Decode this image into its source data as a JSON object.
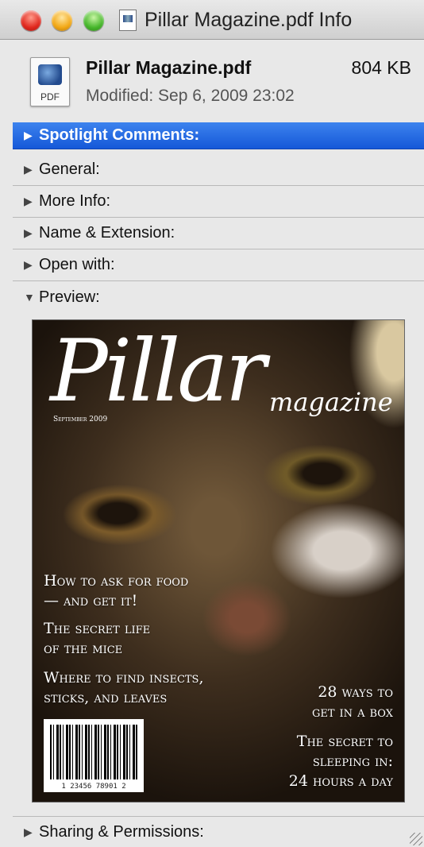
{
  "window": {
    "title": "Pillar Magazine.pdf Info"
  },
  "header": {
    "icon_label": "PDF",
    "file_name": "Pillar Magazine.pdf",
    "file_size": "804 KB",
    "modified": "Modified: Sep 6, 2009 23:02"
  },
  "sections": {
    "spotlight": "Spotlight Comments:",
    "general": "General:",
    "more_info": "More Info:",
    "name_extension": "Name & Extension:",
    "open_with": "Open with:",
    "preview": "Preview:",
    "sharing": "Sharing & Permissions:"
  },
  "triangles": {
    "collapsed": "▶",
    "expanded": "▼"
  },
  "cover": {
    "title": "Pillar",
    "subtitle": "magazine",
    "date": "September 2009",
    "headline1": "How to ask for food\n— and get it!",
    "headline2": "The secret life\nof the mice",
    "headline3": "Where to find insects,\nsticks, and leaves",
    "headline4": "28 ways to\nget in a box",
    "headline5": "The secret to\nsleeping in:\n24 hours a day",
    "barcode_number": "1 23456 78901 2"
  },
  "colors": {
    "selection": "#1a5fe0",
    "window_bg": "#e8e8e8"
  }
}
